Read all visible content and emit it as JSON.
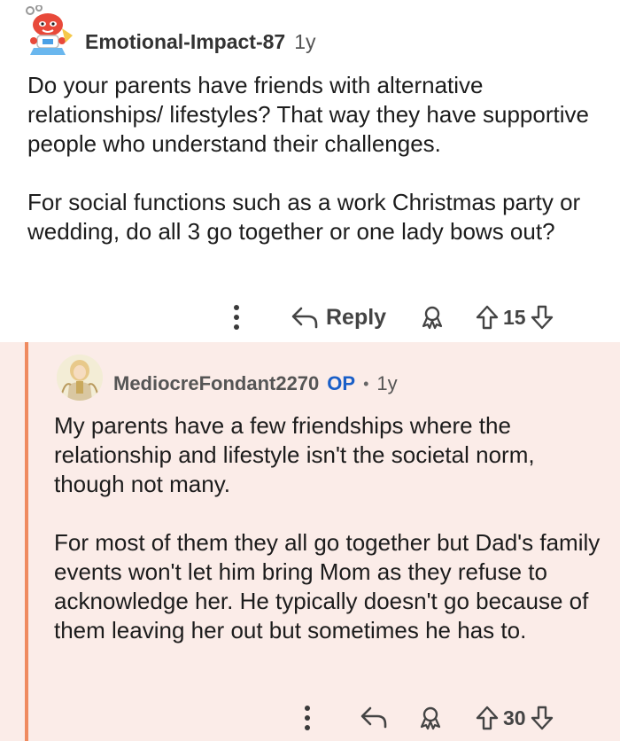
{
  "parent": {
    "username": "Emotional-Impact-87",
    "time": "1y",
    "paragraphs": [
      "Do your parents have friends with alternative relationships/ lifestyles? That way they have supportive people who understand their challenges.",
      "For social functions such as a work Christmas party or wedding, do all 3 go together or one lady bows out?"
    ],
    "actions": {
      "reply_label": "Reply",
      "score": "15"
    }
  },
  "reply": {
    "username": "MediocreFondant2270",
    "op_badge": "OP",
    "separator": "•",
    "time": "1y",
    "paragraphs": [
      "My parents have a few friendships where the relationship and lifestyle isn't the societal norm, though not many.",
      "For most of them they all go together but Dad's family events won't let him bring Mom as they refuse to acknowledge her. He typically doesn't go because of them leaving her out but sometimes he has to."
    ],
    "actions": {
      "score": "30"
    }
  },
  "colors": {
    "thread_line": "#ef8a5f",
    "reply_background": "#fbece8",
    "op_badge": "#1a5fc8"
  }
}
